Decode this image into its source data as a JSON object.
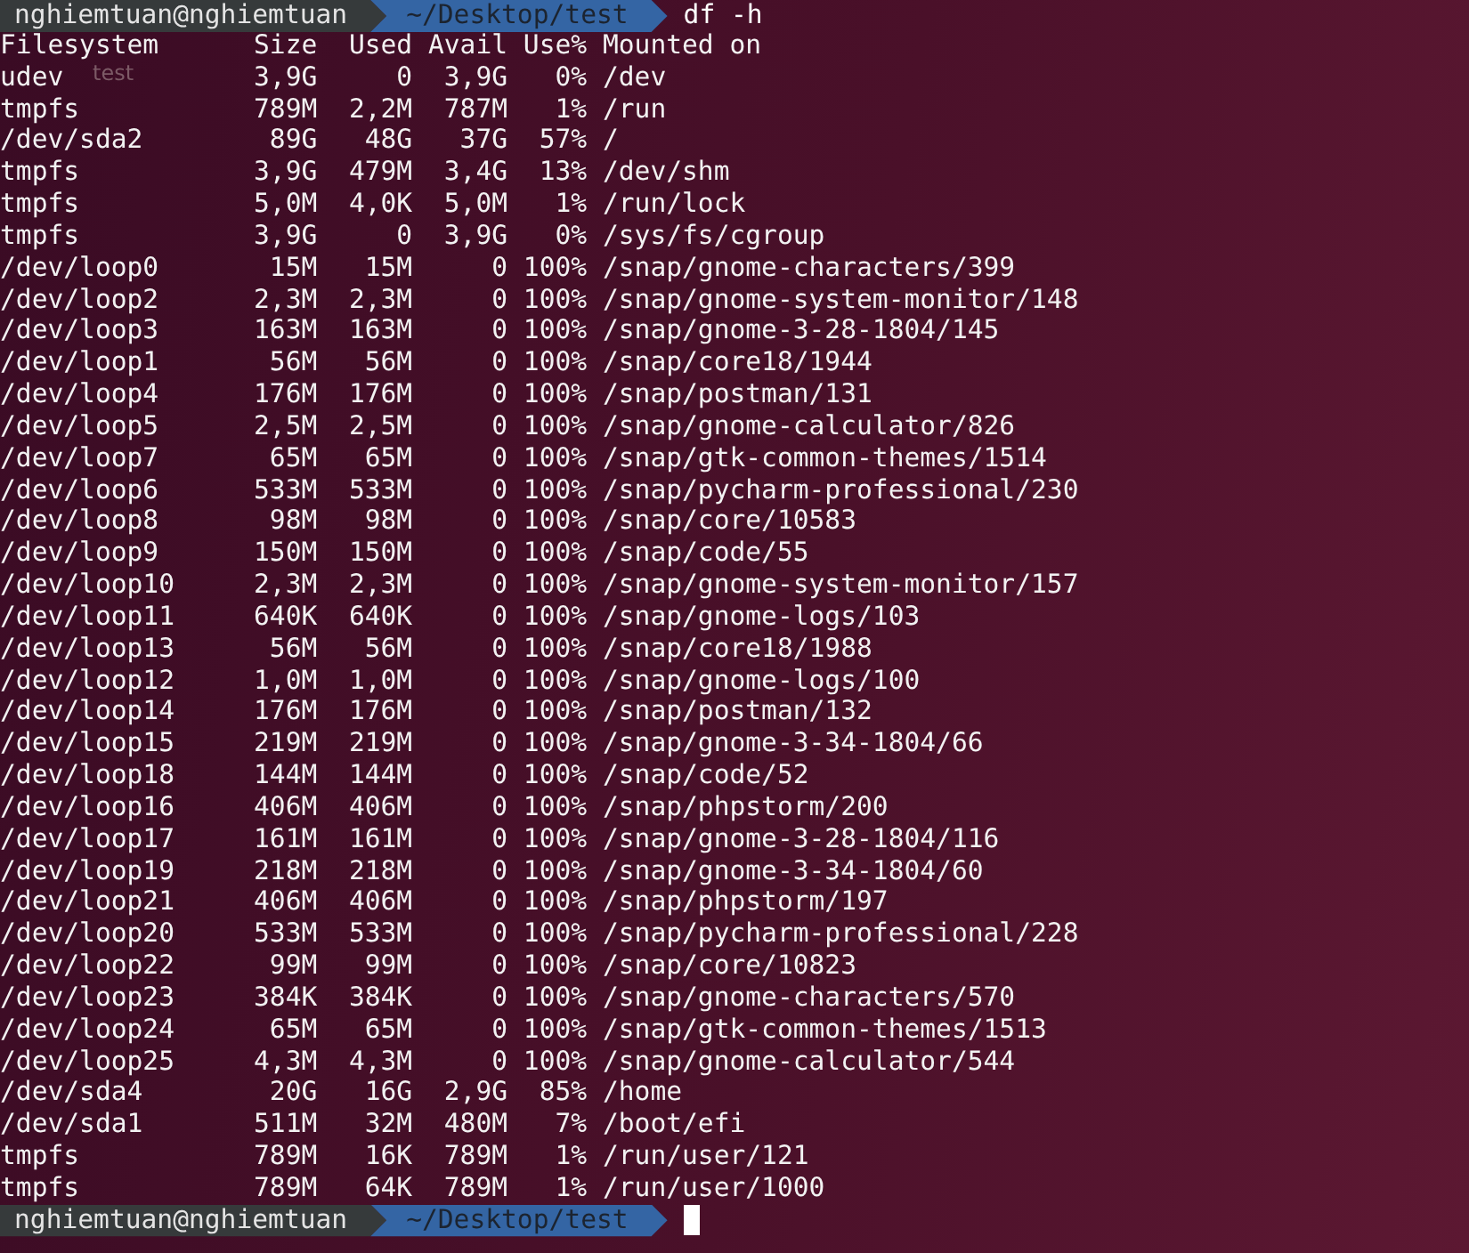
{
  "prompts": [
    {
      "user": "nghiemtuan@nghiemtuan",
      "path": "~/Desktop/test",
      "command": "df -h"
    },
    {
      "user": "nghiemtuan@nghiemtuan",
      "path": "~/Desktop/test",
      "cursor": true
    }
  ],
  "ghost_label": "test",
  "header": {
    "filesystem": "Filesystem",
    "size": "Size",
    "used": "Used",
    "avail": "Avail",
    "use_pct": "Use%",
    "mounted_on": "Mounted on"
  },
  "rows": [
    {
      "filesystem": "udev",
      "size": "3,9G",
      "used": "0",
      "avail": "3,9G",
      "use_pct": "0%",
      "mounted_on": "/dev"
    },
    {
      "filesystem": "tmpfs",
      "size": "789M",
      "used": "2,2M",
      "avail": "787M",
      "use_pct": "1%",
      "mounted_on": "/run"
    },
    {
      "filesystem": "/dev/sda2",
      "size": "89G",
      "used": "48G",
      "avail": "37G",
      "use_pct": "57%",
      "mounted_on": "/"
    },
    {
      "filesystem": "tmpfs",
      "size": "3,9G",
      "used": "479M",
      "avail": "3,4G",
      "use_pct": "13%",
      "mounted_on": "/dev/shm"
    },
    {
      "filesystem": "tmpfs",
      "size": "5,0M",
      "used": "4,0K",
      "avail": "5,0M",
      "use_pct": "1%",
      "mounted_on": "/run/lock"
    },
    {
      "filesystem": "tmpfs",
      "size": "3,9G",
      "used": "0",
      "avail": "3,9G",
      "use_pct": "0%",
      "mounted_on": "/sys/fs/cgroup"
    },
    {
      "filesystem": "/dev/loop0",
      "size": "15M",
      "used": "15M",
      "avail": "0",
      "use_pct": "100%",
      "mounted_on": "/snap/gnome-characters/399"
    },
    {
      "filesystem": "/dev/loop2",
      "size": "2,3M",
      "used": "2,3M",
      "avail": "0",
      "use_pct": "100%",
      "mounted_on": "/snap/gnome-system-monitor/148"
    },
    {
      "filesystem": "/dev/loop3",
      "size": "163M",
      "used": "163M",
      "avail": "0",
      "use_pct": "100%",
      "mounted_on": "/snap/gnome-3-28-1804/145"
    },
    {
      "filesystem": "/dev/loop1",
      "size": "56M",
      "used": "56M",
      "avail": "0",
      "use_pct": "100%",
      "mounted_on": "/snap/core18/1944"
    },
    {
      "filesystem": "/dev/loop4",
      "size": "176M",
      "used": "176M",
      "avail": "0",
      "use_pct": "100%",
      "mounted_on": "/snap/postman/131"
    },
    {
      "filesystem": "/dev/loop5",
      "size": "2,5M",
      "used": "2,5M",
      "avail": "0",
      "use_pct": "100%",
      "mounted_on": "/snap/gnome-calculator/826"
    },
    {
      "filesystem": "/dev/loop7",
      "size": "65M",
      "used": "65M",
      "avail": "0",
      "use_pct": "100%",
      "mounted_on": "/snap/gtk-common-themes/1514"
    },
    {
      "filesystem": "/dev/loop6",
      "size": "533M",
      "used": "533M",
      "avail": "0",
      "use_pct": "100%",
      "mounted_on": "/snap/pycharm-professional/230"
    },
    {
      "filesystem": "/dev/loop8",
      "size": "98M",
      "used": "98M",
      "avail": "0",
      "use_pct": "100%",
      "mounted_on": "/snap/core/10583"
    },
    {
      "filesystem": "/dev/loop9",
      "size": "150M",
      "used": "150M",
      "avail": "0",
      "use_pct": "100%",
      "mounted_on": "/snap/code/55"
    },
    {
      "filesystem": "/dev/loop10",
      "size": "2,3M",
      "used": "2,3M",
      "avail": "0",
      "use_pct": "100%",
      "mounted_on": "/snap/gnome-system-monitor/157"
    },
    {
      "filesystem": "/dev/loop11",
      "size": "640K",
      "used": "640K",
      "avail": "0",
      "use_pct": "100%",
      "mounted_on": "/snap/gnome-logs/103"
    },
    {
      "filesystem": "/dev/loop13",
      "size": "56M",
      "used": "56M",
      "avail": "0",
      "use_pct": "100%",
      "mounted_on": "/snap/core18/1988"
    },
    {
      "filesystem": "/dev/loop12",
      "size": "1,0M",
      "used": "1,0M",
      "avail": "0",
      "use_pct": "100%",
      "mounted_on": "/snap/gnome-logs/100"
    },
    {
      "filesystem": "/dev/loop14",
      "size": "176M",
      "used": "176M",
      "avail": "0",
      "use_pct": "100%",
      "mounted_on": "/snap/postman/132"
    },
    {
      "filesystem": "/dev/loop15",
      "size": "219M",
      "used": "219M",
      "avail": "0",
      "use_pct": "100%",
      "mounted_on": "/snap/gnome-3-34-1804/66"
    },
    {
      "filesystem": "/dev/loop18",
      "size": "144M",
      "used": "144M",
      "avail": "0",
      "use_pct": "100%",
      "mounted_on": "/snap/code/52"
    },
    {
      "filesystem": "/dev/loop16",
      "size": "406M",
      "used": "406M",
      "avail": "0",
      "use_pct": "100%",
      "mounted_on": "/snap/phpstorm/200"
    },
    {
      "filesystem": "/dev/loop17",
      "size": "161M",
      "used": "161M",
      "avail": "0",
      "use_pct": "100%",
      "mounted_on": "/snap/gnome-3-28-1804/116"
    },
    {
      "filesystem": "/dev/loop19",
      "size": "218M",
      "used": "218M",
      "avail": "0",
      "use_pct": "100%",
      "mounted_on": "/snap/gnome-3-34-1804/60"
    },
    {
      "filesystem": "/dev/loop21",
      "size": "406M",
      "used": "406M",
      "avail": "0",
      "use_pct": "100%",
      "mounted_on": "/snap/phpstorm/197"
    },
    {
      "filesystem": "/dev/loop20",
      "size": "533M",
      "used": "533M",
      "avail": "0",
      "use_pct": "100%",
      "mounted_on": "/snap/pycharm-professional/228"
    },
    {
      "filesystem": "/dev/loop22",
      "size": "99M",
      "used": "99M",
      "avail": "0",
      "use_pct": "100%",
      "mounted_on": "/snap/core/10823"
    },
    {
      "filesystem": "/dev/loop23",
      "size": "384K",
      "used": "384K",
      "avail": "0",
      "use_pct": "100%",
      "mounted_on": "/snap/gnome-characters/570"
    },
    {
      "filesystem": "/dev/loop24",
      "size": "65M",
      "used": "65M",
      "avail": "0",
      "use_pct": "100%",
      "mounted_on": "/snap/gtk-common-themes/1513"
    },
    {
      "filesystem": "/dev/loop25",
      "size": "4,3M",
      "used": "4,3M",
      "avail": "0",
      "use_pct": "100%",
      "mounted_on": "/snap/gnome-calculator/544"
    },
    {
      "filesystem": "/dev/sda4",
      "size": "20G",
      "used": "16G",
      "avail": "2,9G",
      "use_pct": "85%",
      "mounted_on": "/home"
    },
    {
      "filesystem": "/dev/sda1",
      "size": "511M",
      "used": "32M",
      "avail": "480M",
      "use_pct": "7%",
      "mounted_on": "/boot/efi"
    },
    {
      "filesystem": "tmpfs",
      "size": "789M",
      "used": "16K",
      "avail": "789M",
      "use_pct": "1%",
      "mounted_on": "/run/user/121"
    },
    {
      "filesystem": "tmpfs",
      "size": "789M",
      "used": "64K",
      "avail": "789M",
      "use_pct": "1%",
      "mounted_on": "/run/user/1000"
    }
  ]
}
